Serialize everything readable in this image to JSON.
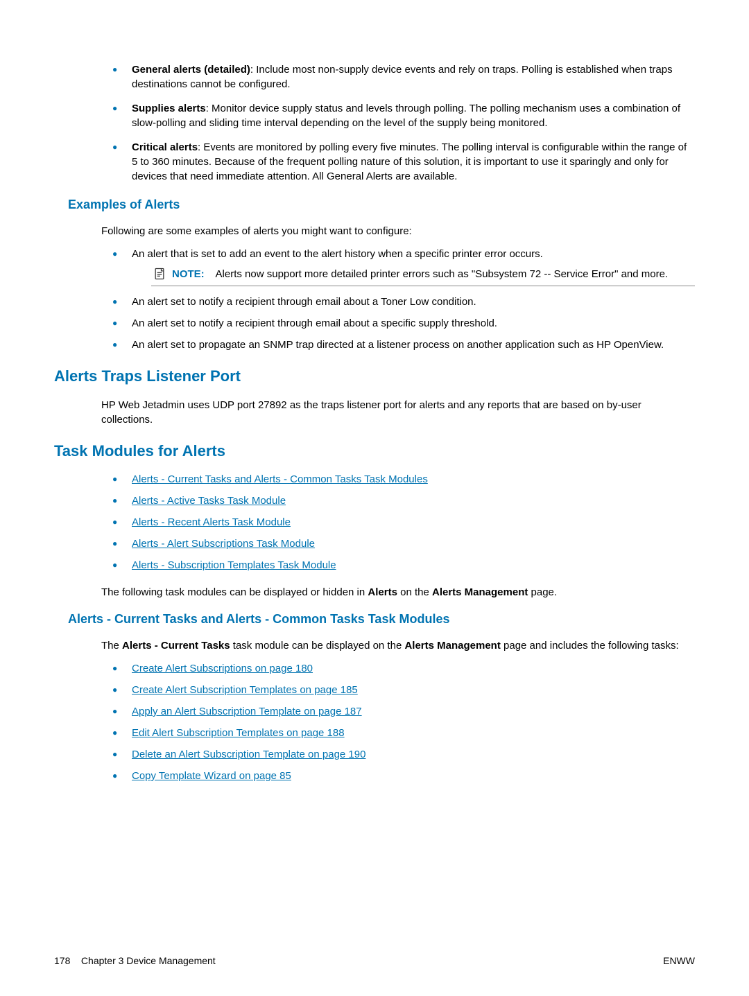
{
  "top_bullets": [
    {
      "bold": "General alerts (detailed)",
      "rest": ": Include most non-supply device events and rely on traps. Polling is established when traps destinations cannot be configured."
    },
    {
      "bold": "Supplies alerts",
      "rest": ": Monitor device supply status and levels through polling. The polling mechanism uses a combination of slow-polling and sliding time interval depending on the level of the supply being monitored."
    },
    {
      "bold": "Critical alerts",
      "rest": ": Events are monitored by polling every five minutes. The polling interval is configurable within the range of 5 to 360 minutes. Because of the frequent polling nature of this solution, it is important to use it sparingly and only for devices that need immediate attention. All General Alerts are available."
    }
  ],
  "examples": {
    "heading": "Examples of Alerts",
    "intro": "Following are some examples of alerts you might want to configure:",
    "bullets": [
      "An alert that is set to add an event to the alert history when a specific printer error occurs.",
      "An alert set to notify a recipient through email about a Toner Low condition.",
      "An alert set to notify a recipient through email about a specific supply threshold.",
      "An alert set to propagate an SNMP trap directed at a listener process on another application such as HP OpenView."
    ],
    "note_label": "NOTE:",
    "note_text": "Alerts now support more detailed printer errors such as \"Subsystem 72 -- Service Error\" and more."
  },
  "listener": {
    "heading": "Alerts Traps Listener Port",
    "text": "HP Web Jetadmin uses UDP port 27892 as the traps listener port for alerts and any reports that are based on by-user collections."
  },
  "task_modules": {
    "heading": "Task Modules for Alerts",
    "links": [
      "Alerts - Current Tasks and Alerts - Common Tasks Task Modules",
      "Alerts - Active Tasks Task Module",
      "Alerts - Recent Alerts Task Module",
      "Alerts - Alert Subscriptions Task Module",
      "Alerts - Subscription Templates Task Module"
    ],
    "summary_pre": "The following task modules can be displayed or hidden in ",
    "summary_bold1": "Alerts",
    "summary_mid": " on the ",
    "summary_bold2": "Alerts Management",
    "summary_post": " page."
  },
  "current_tasks": {
    "heading": "Alerts - Current Tasks and Alerts - Common Tasks Task Modules",
    "intro_pre": "The ",
    "intro_bold1": "Alerts - Current Tasks",
    "intro_mid": " task module can be displayed on the ",
    "intro_bold2": "Alerts Management",
    "intro_post": " page and includes the following tasks:",
    "links": [
      "Create Alert Subscriptions on page 180",
      "Create Alert Subscription Templates on page 185",
      "Apply an Alert Subscription Template on page 187",
      "Edit Alert Subscription Templates on page 188",
      "Delete an Alert Subscription Template on page 190",
      "Copy Template Wizard on page 85"
    ]
  },
  "footer": {
    "page_num": "178",
    "chapter": "Chapter 3   Device Management",
    "right": "ENWW"
  }
}
